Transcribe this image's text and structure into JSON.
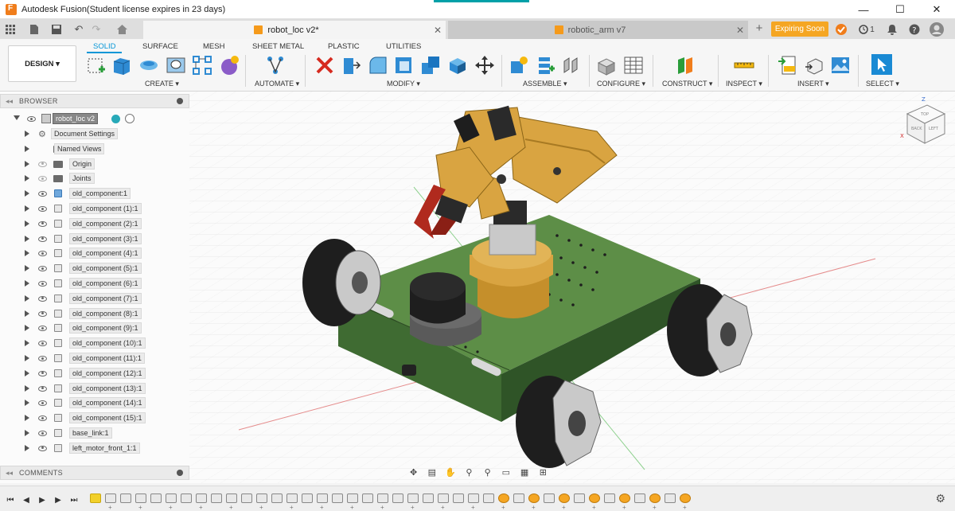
{
  "window": {
    "title": "Autodesk Fusion(Student license expires in 23 days)",
    "controls": {
      "minimize": "—",
      "maximize": "☐",
      "close": "✕"
    }
  },
  "tabs": [
    {
      "label": "robot_loc v2*",
      "active": true
    },
    {
      "label": "robotic_arm v7",
      "active": false
    }
  ],
  "tabbar_right": {
    "expiring_label": "Expiring Soon",
    "job_count": "1"
  },
  "ribbon": {
    "workspace_button": "DESIGN ▾",
    "tabs": [
      "SOLID",
      "SURFACE",
      "MESH",
      "SHEET METAL",
      "PLASTIC",
      "UTILITIES"
    ],
    "active_tab": "SOLID",
    "groups": [
      "CREATE ▾",
      "AUTOMATE ▾",
      "MODIFY ▾",
      "ASSEMBLE ▾",
      "CONFIGURE ▾",
      "CONSTRUCT ▾",
      "INSPECT ▾",
      "INSERT ▾",
      "SELECT ▾"
    ],
    "accent_color": "#0696d7"
  },
  "browser": {
    "header": "BROWSER",
    "root": "robot_loc v2",
    "items": [
      {
        "label": "Document Settings",
        "icon": "gear-icon",
        "eye": false
      },
      {
        "label": "Named Views",
        "icon": "folder-icon",
        "eye": false
      },
      {
        "label": "Origin",
        "icon": "folder-icon",
        "eye": "hidden"
      },
      {
        "label": "Joints",
        "icon": "folder-icon",
        "eye": "hidden"
      },
      {
        "label": "old_component:1",
        "icon": "component-icon",
        "eye": true
      },
      {
        "label": "old_component (1):1",
        "icon": "component-icon",
        "eye": true
      },
      {
        "label": "old_component (2):1",
        "icon": "component-icon",
        "eye": true
      },
      {
        "label": "old_component (3):1",
        "icon": "component-icon",
        "eye": true
      },
      {
        "label": "old_component (4):1",
        "icon": "component-icon",
        "eye": true
      },
      {
        "label": "old_component (5):1",
        "icon": "component-icon",
        "eye": true
      },
      {
        "label": "old_component (6):1",
        "icon": "component-icon",
        "eye": true
      },
      {
        "label": "old_component (7):1",
        "icon": "component-icon",
        "eye": true
      },
      {
        "label": "old_component (8):1",
        "icon": "component-icon",
        "eye": true
      },
      {
        "label": "old_component (9):1",
        "icon": "component-icon",
        "eye": true
      },
      {
        "label": "old_component (10):1",
        "icon": "component-icon",
        "eye": true
      },
      {
        "label": "old_component (11):1",
        "icon": "component-icon",
        "eye": true
      },
      {
        "label": "old_component (12):1",
        "icon": "component-icon",
        "eye": true
      },
      {
        "label": "old_component (13):1",
        "icon": "component-icon",
        "eye": true
      },
      {
        "label": "old_component (14):1",
        "icon": "component-icon",
        "eye": true
      },
      {
        "label": "old_component (15):1",
        "icon": "component-icon",
        "eye": true
      },
      {
        "label": "base_link:1",
        "icon": "component-icon",
        "eye": true
      },
      {
        "label": "left_motor_front_1:1",
        "icon": "component-icon",
        "eye": true
      }
    ]
  },
  "comments": {
    "header": "COMMENTS"
  },
  "viewcube": {
    "faces": [
      "TOP",
      "BACK",
      "LEFT"
    ],
    "axes": [
      "Z",
      "X"
    ]
  },
  "colors": {
    "chassis_green": "#4a7c3a",
    "arm_gold": "#d9a441",
    "wheel_dark": "#1e1e1e",
    "wheel_silver": "#c9c9c9",
    "gripper_red": "#b02a1e"
  }
}
